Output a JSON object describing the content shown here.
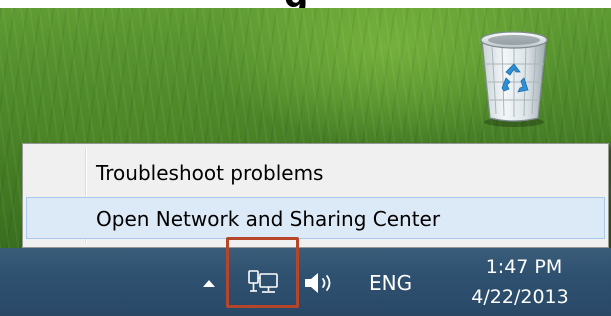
{
  "page_header": {
    "partial_text": "g"
  },
  "desktop": {
    "recycle_bin": {
      "icon": "recycle-bin-icon"
    }
  },
  "context_menu": {
    "items": [
      {
        "label": "Troubleshoot problems",
        "hovered": false
      },
      {
        "label": "Open Network and Sharing Center",
        "hovered": true
      }
    ]
  },
  "taskbar": {
    "show_hidden_icons": "chevron-up-icon",
    "network_icon": "network-icon",
    "volume_icon": "volume-icon",
    "language": "ENG",
    "clock": {
      "time": "1:47 PM",
      "date": "4/22/2013"
    }
  },
  "colors": {
    "menu_hover": "#dce9f7",
    "highlight_box": "#b5462a",
    "taskbar": "#2f5170"
  }
}
